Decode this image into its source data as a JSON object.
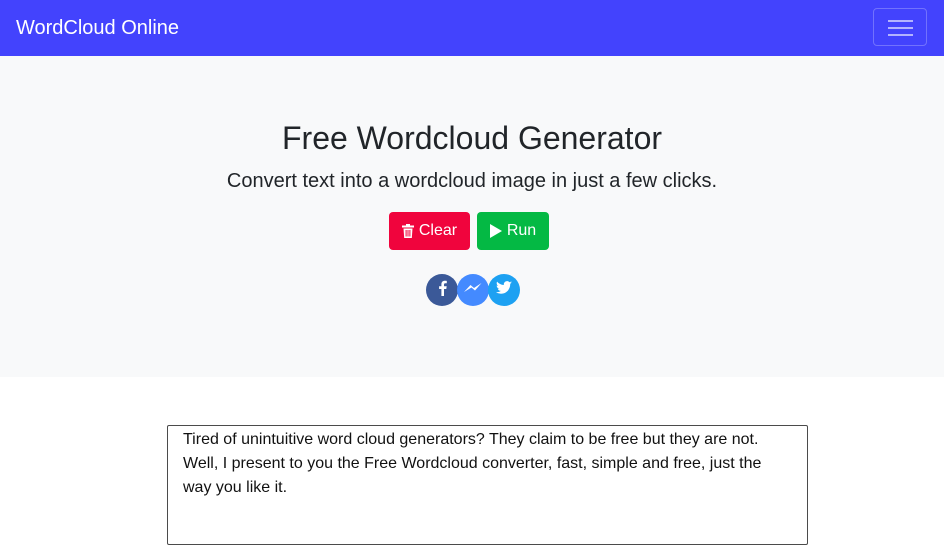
{
  "navbar": {
    "brand": "WordCloud Online",
    "menu_icon": "hamburger-menu-icon",
    "background": "#4343fd"
  },
  "hero": {
    "title": "Free Wordcloud Generator",
    "subtitle": "Convert text into a wordcloud image in just a few clicks.",
    "buttons": {
      "clear": {
        "label": "Clear",
        "icon": "trash-icon",
        "color": "#f0043d"
      },
      "run": {
        "label": "Run",
        "icon": "play-icon",
        "color": "#04b944"
      }
    },
    "social": [
      {
        "name": "facebook",
        "icon": "facebook-icon",
        "color": "#3b5998"
      },
      {
        "name": "messenger",
        "icon": "messenger-icon",
        "color": "#448aff"
      },
      {
        "name": "twitter",
        "icon": "twitter-icon",
        "color": "#1da1f2"
      }
    ]
  },
  "editor": {
    "text": "Tired of unintuitive word cloud generators? They claim to be free but they are not. Well, I present to you the Free Wordcloud converter, fast, simple and free, just the way you like it."
  }
}
